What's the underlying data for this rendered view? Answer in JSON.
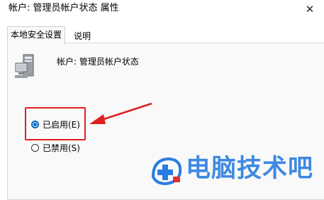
{
  "window": {
    "title": "帐户: 管理员帐户状态 属性",
    "close_label": "✕"
  },
  "tabs": [
    {
      "label": "本地安全设置",
      "active": true
    },
    {
      "label": "说明",
      "active": false
    }
  ],
  "panel": {
    "account_label": "帐户: 管理员帐户状态",
    "options": [
      {
        "label": "已启用(E)",
        "checked": true
      },
      {
        "label": "已禁用(S)",
        "checked": false
      }
    ]
  },
  "watermark": {
    "text": "电脑技术吧",
    "icon": "plus-circle-icon"
  },
  "colors": {
    "accent": "#0067c0",
    "highlight": "#e02020",
    "watermark": "#2a7de0"
  }
}
